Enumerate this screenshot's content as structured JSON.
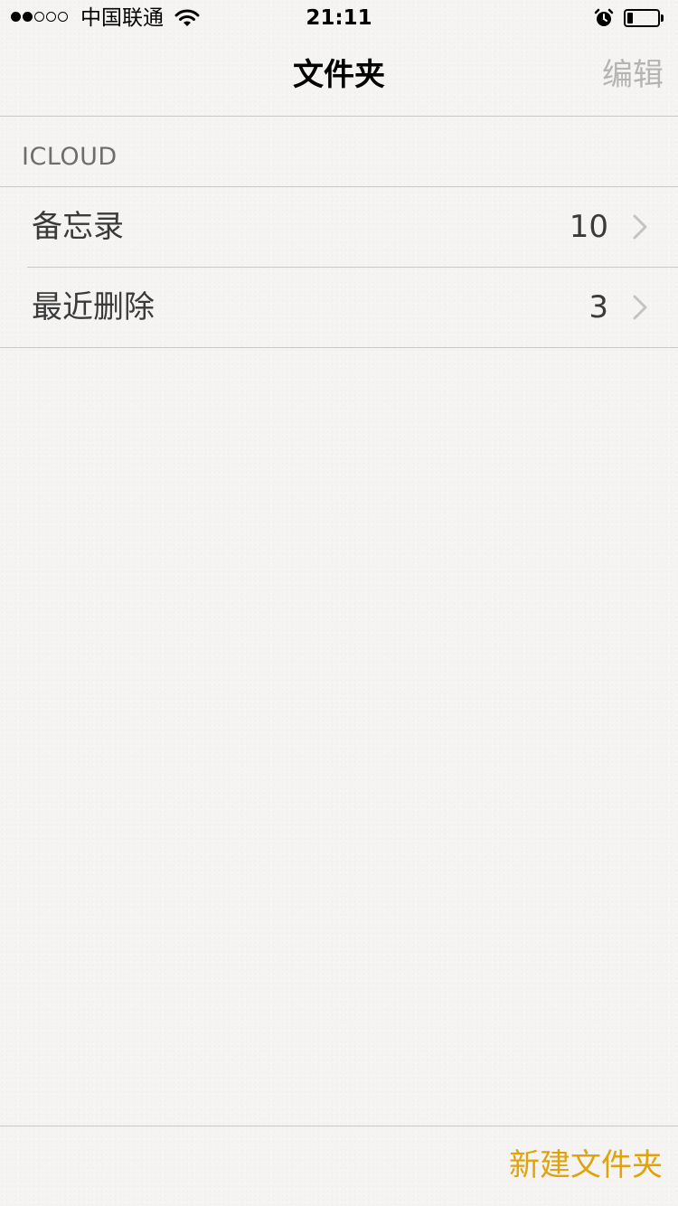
{
  "status_bar": {
    "signal_filled": 2,
    "signal_empty": 3,
    "carrier": "中国联通",
    "wifi_icon": "wifi-icon",
    "time": "21:11",
    "alarm_icon": "alarm-clock-icon",
    "battery_level": 0.2
  },
  "nav": {
    "title": "文件夹",
    "edit_label": "编辑"
  },
  "section": {
    "header": "ICLOUD"
  },
  "folders": [
    {
      "name": "备忘录",
      "count": "10"
    },
    {
      "name": "最近删除",
      "count": "3"
    }
  ],
  "toolbar": {
    "new_folder_label": "新建文件夹"
  },
  "colors": {
    "accent": "#e0a20d",
    "edit_disabled": "#b5b4b2",
    "separator": "#c9c8c6",
    "background": "#f5f4f2"
  }
}
